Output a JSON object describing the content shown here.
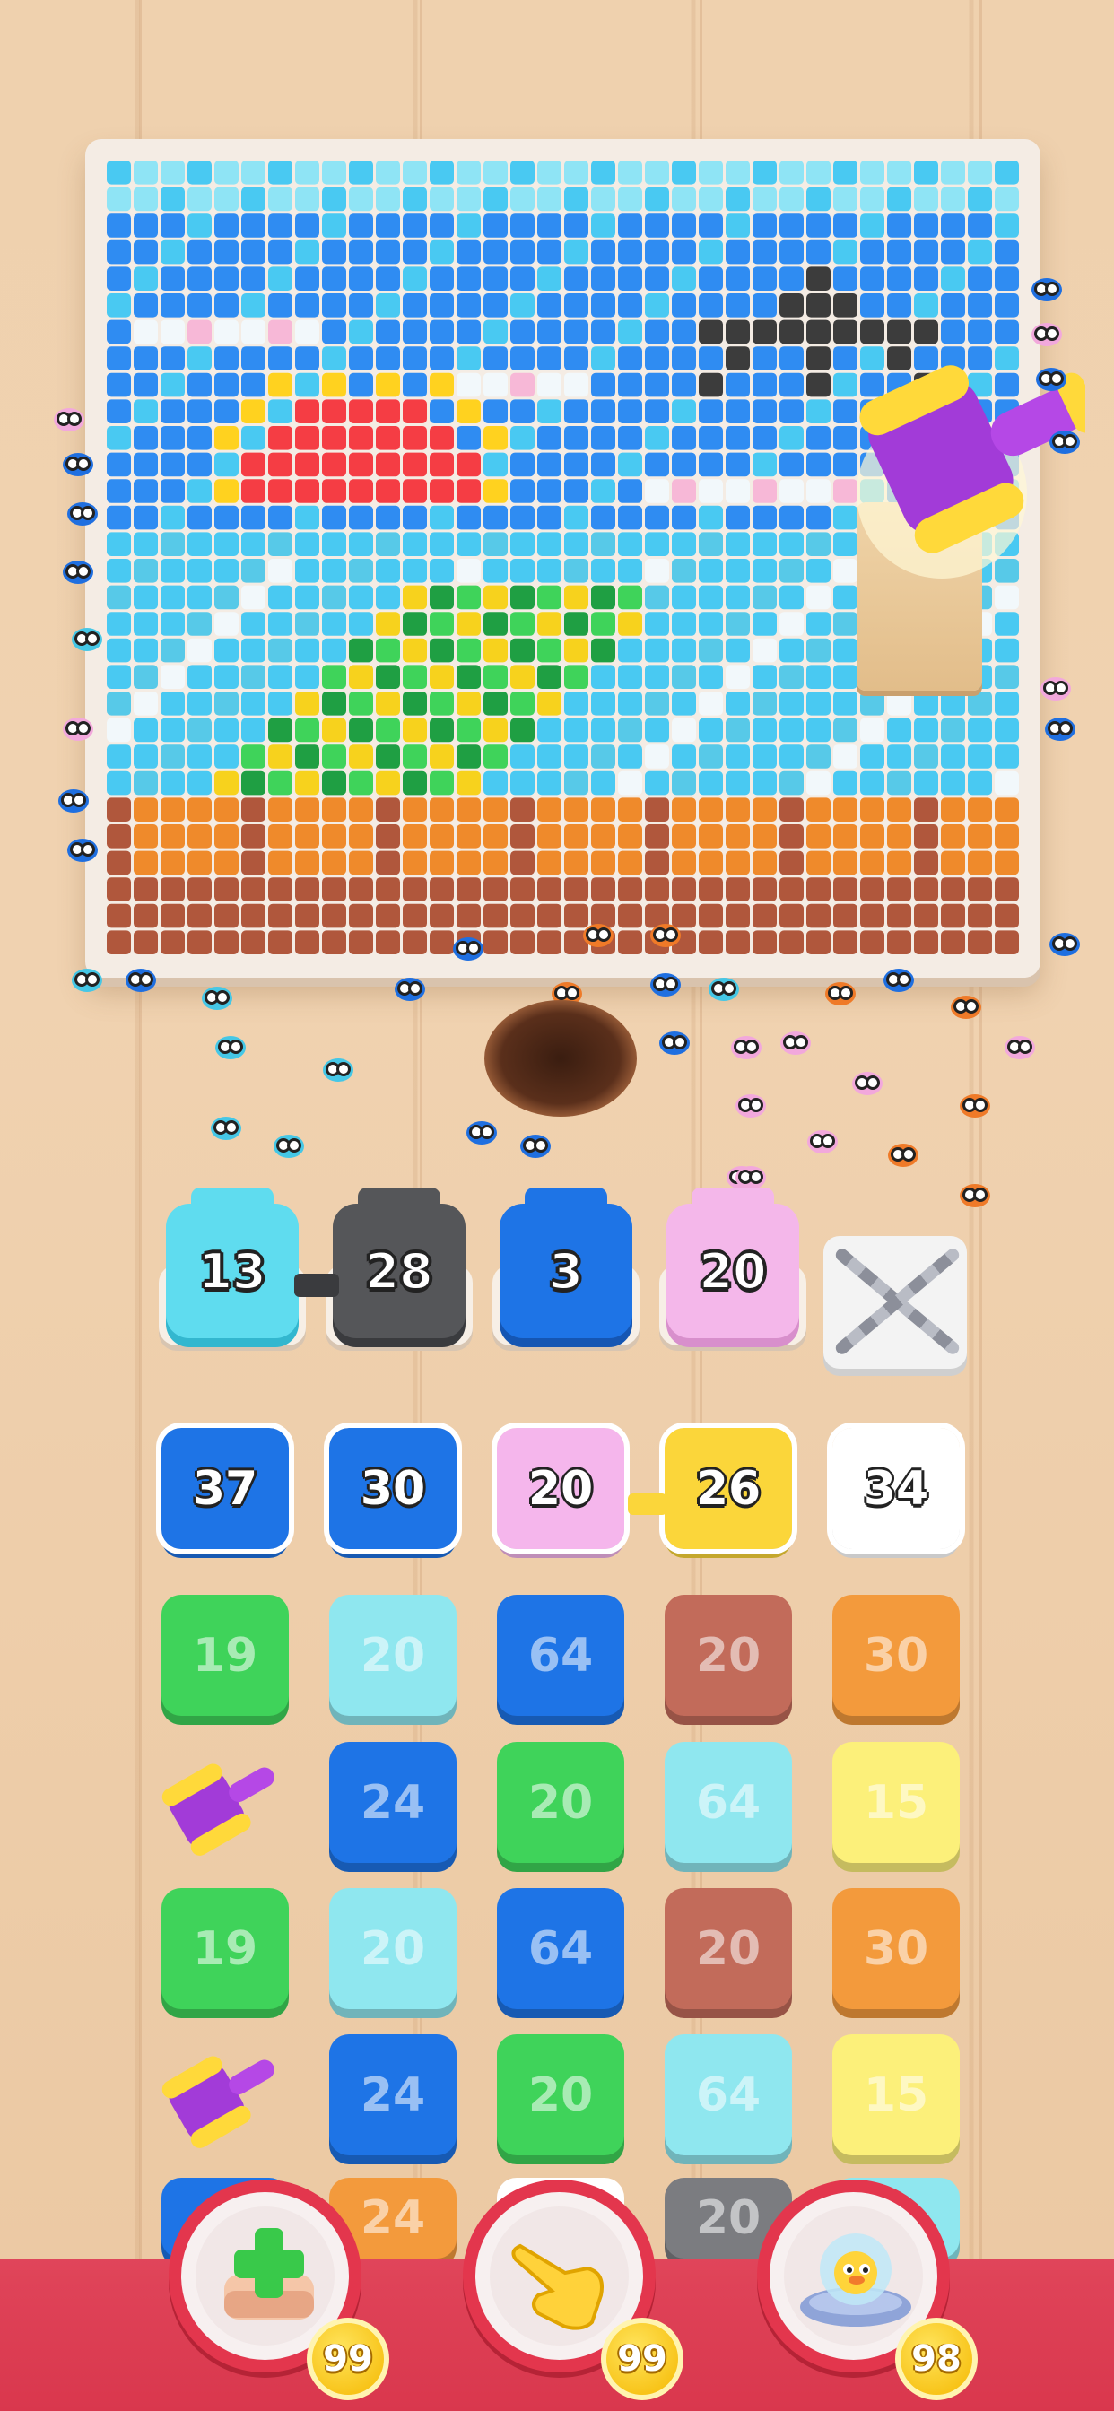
{
  "slots": [
    {
      "value": "13",
      "color": "#5fdcef",
      "shade": "#33b7cf"
    },
    {
      "value": "28",
      "color": "#555659",
      "shade": "#3a3b3e"
    },
    {
      "value": "3",
      "color": "#1e74e6",
      "shade": "#1556b3"
    },
    {
      "value": "20",
      "color": "#f4b7ea",
      "shade": "#d88fcc"
    }
  ],
  "grid": [
    [
      "37",
      "30",
      "20",
      "26",
      "34"
    ],
    [
      "19",
      "20",
      "64",
      "20",
      "30"
    ],
    [
      "hammer",
      "24",
      "20",
      "64",
      "15"
    ],
    [
      "19",
      "20",
      "64",
      "20",
      "30"
    ],
    [
      "hammer",
      "24",
      "20",
      "64",
      "15"
    ],
    [
      "",
      "24",
      "",
      "20",
      ""
    ]
  ],
  "grid_colors": {
    "blue": "#1e74e6",
    "pink": "#f5b6ec",
    "yellow": "#fbd63a",
    "white": "#ffffff",
    "green": "#3fd35a",
    "cyan": "#8fe7ef",
    "brown": "#c26b5a",
    "orange": "#f39a3c",
    "lightyellow": "#fcf07a",
    "gray": "#7b7c80"
  },
  "boosters": [
    {
      "name": "add-slot",
      "count": "99"
    },
    {
      "name": "hand",
      "count": "99"
    },
    {
      "name": "ufo",
      "count": "98"
    }
  ]
}
